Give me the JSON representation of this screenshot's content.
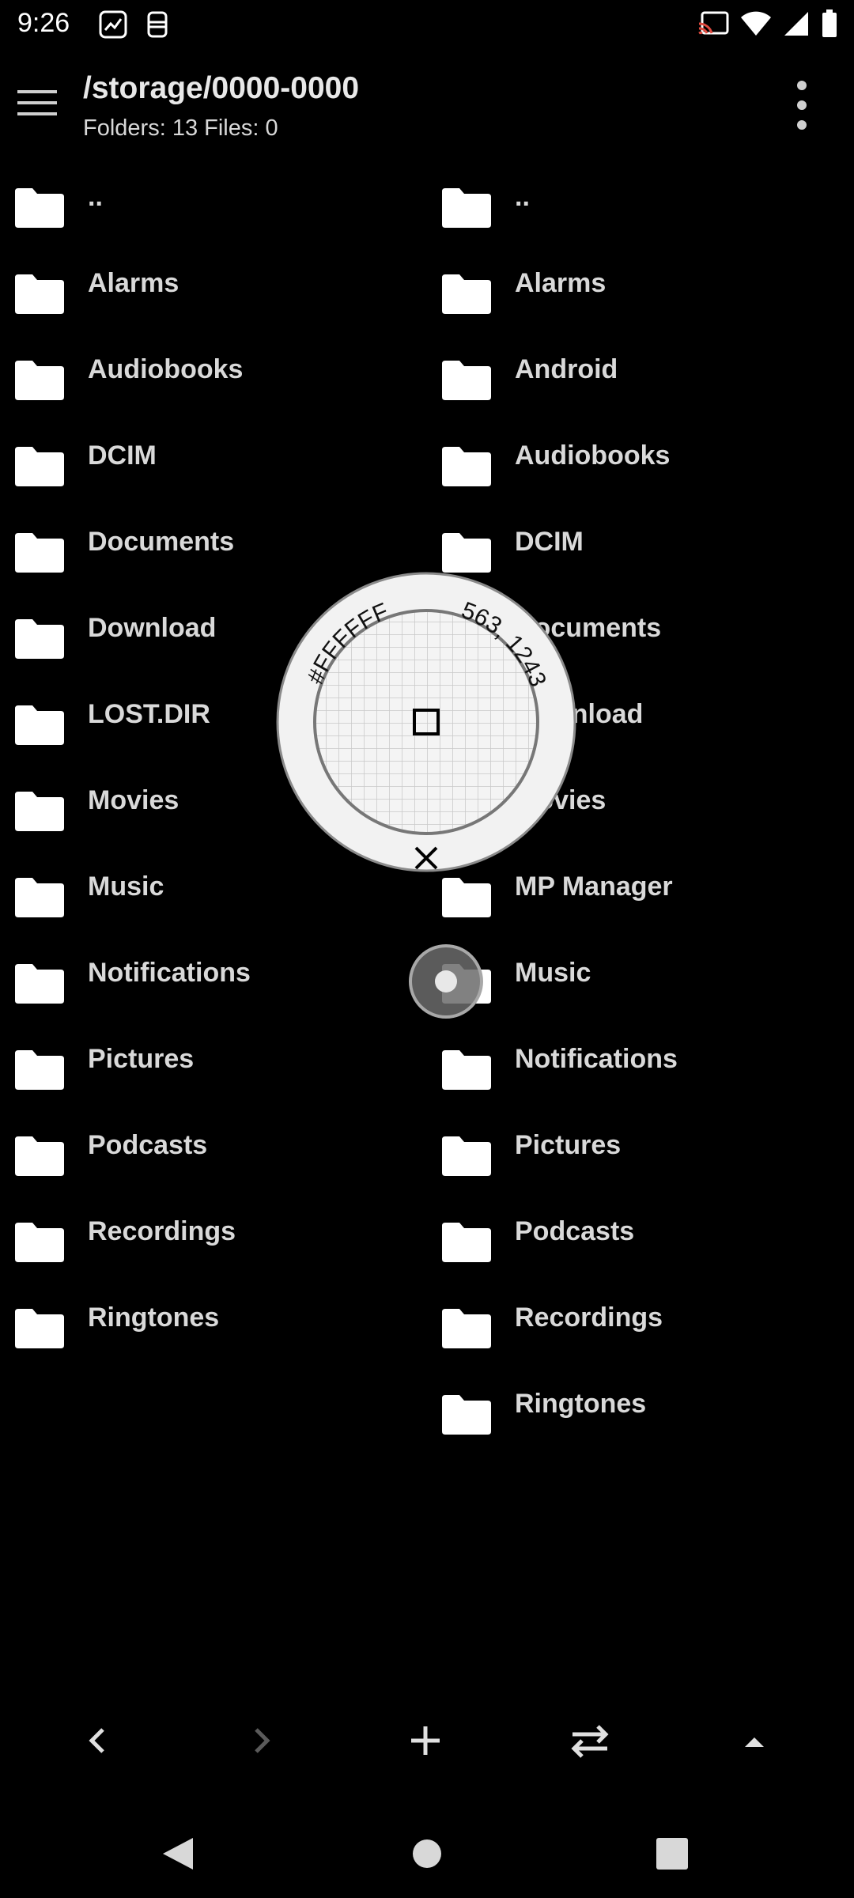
{
  "status_bar": {
    "time": "9:26",
    "left_icons": [
      "trending-chart-icon",
      "lock-screen-icon"
    ],
    "right_icons": [
      "cast-icon",
      "wifi-icon",
      "signal-icon",
      "battery-icon"
    ]
  },
  "app_bar": {
    "path": "/storage/0000-0000",
    "summary": "Folders: 13 Files: 0",
    "icons": [
      "menu-icon",
      "more-vert-icon"
    ]
  },
  "left_pane": {
    "items": [
      "..",
      "Alarms",
      "Audiobooks",
      "DCIM",
      "Documents",
      "Download",
      "LOST.DIR",
      "Movies",
      "Music",
      "Notifications",
      "Pictures",
      "Podcasts",
      "Recordings",
      "Ringtones"
    ]
  },
  "right_pane": {
    "items": [
      "..",
      "Alarms",
      "Android",
      "Audiobooks",
      "DCIM",
      "Documents",
      "Download",
      "Movies",
      "MP Manager",
      "Music",
      "Notifications",
      "Pictures",
      "Podcasts",
      "Recordings",
      "Ringtones"
    ]
  },
  "magnifier": {
    "color_hex": "#FFFFFF",
    "coordinates": "563, 1243",
    "close_icon": "close-icon"
  },
  "bottom_bar": {
    "icons": [
      "chevron-left-icon",
      "chevron-right-icon",
      "plus-icon",
      "swap-icon",
      "arrow-up-icon"
    ]
  },
  "nav_bar": {
    "icons": [
      "back-triangle-icon",
      "home-circle-icon",
      "recents-square-icon"
    ]
  },
  "colors": {
    "background": "#000000",
    "text": "#D9D9D9",
    "icon": "#FFFFFF",
    "disabled_icon": "#5A5A5A"
  }
}
